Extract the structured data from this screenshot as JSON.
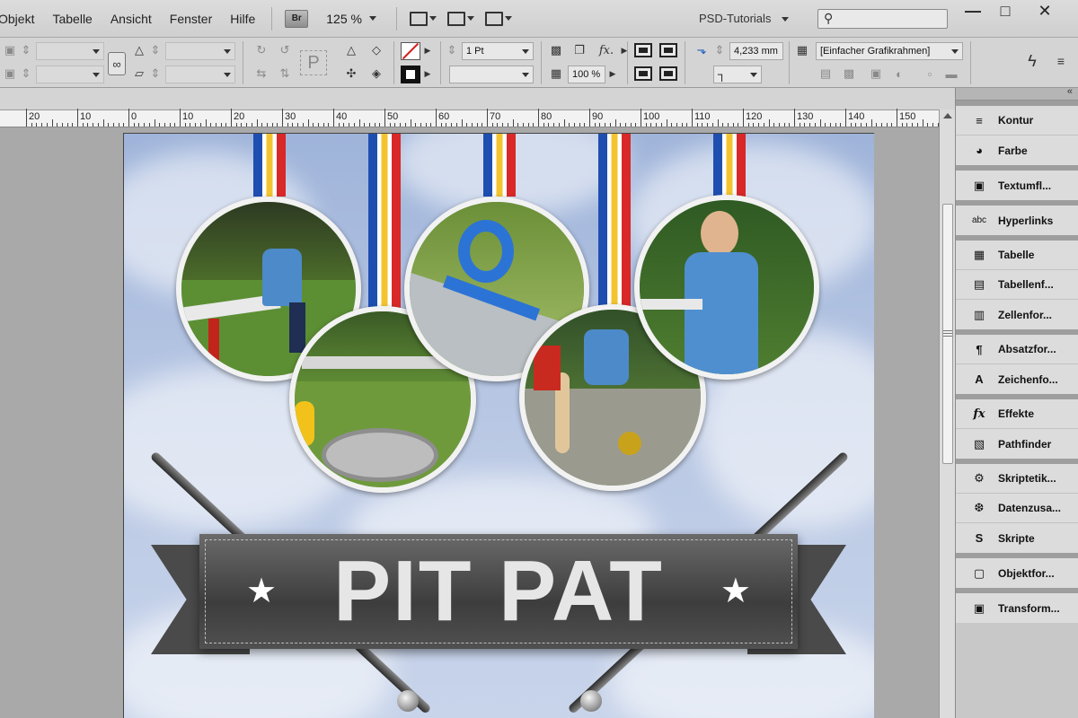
{
  "menubar": {
    "items": [
      "Objekt",
      "Tabelle",
      "Ansicht",
      "Fenster",
      "Hilfe"
    ],
    "bridge_label": "Br",
    "zoom": "125 %",
    "workspace": "PSD-Tutorials",
    "search_placeholder": ""
  },
  "window_controls": {
    "minimize": "—",
    "restore": "□",
    "close": "✕"
  },
  "control_bar": {
    "stroke_weight": "1 Pt",
    "opacity": "100 %",
    "offset_value": "4,233 mm",
    "object_style": "[Einfacher Grafikrahmen]",
    "lightning_icon": "ϟ",
    "menu_icon": "≡"
  },
  "ruler": {
    "labels": [
      "20",
      "10",
      "0",
      "10",
      "20",
      "30",
      "40",
      "50",
      "60",
      "70",
      "80",
      "90",
      "100",
      "110",
      "120",
      "130",
      "140",
      "150"
    ]
  },
  "document": {
    "title": "PIT PAT",
    "star": "★"
  },
  "panel": {
    "collapse_label": "«",
    "groups": [
      [
        {
          "label": "Kontur",
          "icon": "stroke-icon"
        },
        {
          "label": "Farbe",
          "icon": "color-icon"
        }
      ],
      [
        {
          "label": "Textumfl...",
          "icon": "text-wrap-icon"
        }
      ],
      [
        {
          "label": "Hyperlinks",
          "icon": "hyperlinks-icon"
        }
      ],
      [
        {
          "label": "Tabelle",
          "icon": "table-icon"
        },
        {
          "label": "Tabellenf...",
          "icon": "table-style-icon"
        },
        {
          "label": "Zellenfor...",
          "icon": "cell-style-icon"
        }
      ],
      [
        {
          "label": "Absatzfor...",
          "icon": "paragraph-style-icon"
        },
        {
          "label": "Zeichenfo...",
          "icon": "character-style-icon"
        }
      ],
      [
        {
          "label": "Effekte",
          "icon": "effects-icon"
        },
        {
          "label": "Pathfinder",
          "icon": "pathfinder-icon"
        }
      ],
      [
        {
          "label": "Skriptetik...",
          "icon": "script-label-icon"
        },
        {
          "label": "Datenzusa...",
          "icon": "data-merge-icon"
        },
        {
          "label": "Skripte",
          "icon": "scripts-icon"
        }
      ],
      [
        {
          "label": "Objektfor...",
          "icon": "object-style-icon"
        }
      ],
      [
        {
          "label": "Transform...",
          "icon": "transform-icon"
        }
      ]
    ]
  },
  "colors": {
    "accent_red": "#d42020",
    "ribbon_blue": "#1e4fb0",
    "ribbon_yellow": "#f4c430",
    "ribbon_red": "#d82828",
    "banner_gray": "#4a4a4a"
  }
}
